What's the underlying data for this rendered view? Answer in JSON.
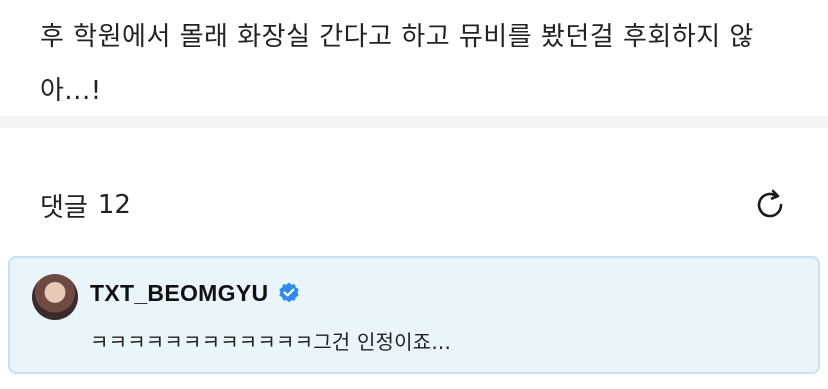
{
  "post": {
    "body": "후 학원에서 몰래 화장실 간다고 하고 뮤비를 봤던걸 후회하지 않아...!"
  },
  "comments": {
    "label": "댓글",
    "count": "12",
    "refresh_icon": "refresh-icon",
    "items": [
      {
        "author": "TXT_BEOMGYU",
        "verified": true,
        "text": "ㅋㅋㅋㅋㅋㅋㅋㅋㅋㅋㅋㅋ그건 인정이죠...",
        "highlight_color": "#eaf4fb"
      }
    ]
  },
  "colors": {
    "verified_badge": "#2f8cea",
    "card_border": "#c7e2f2"
  }
}
